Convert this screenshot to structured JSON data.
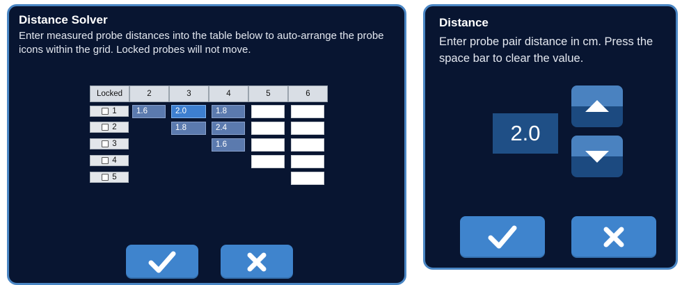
{
  "solver": {
    "title": "Distance Solver",
    "description": "Enter measured probe distances into the table below to auto-arrange the probe icons within the grid.  Locked probes will not move.",
    "headers": [
      "Locked",
      "2",
      "3",
      "4",
      "5",
      "6"
    ],
    "rows": [
      {
        "probe": "1",
        "cells": [
          "1.6",
          "2.0",
          "1.8",
          "",
          ""
        ]
      },
      {
        "probe": "2",
        "cells": [
          "1.8",
          "2.4",
          "",
          ""
        ]
      },
      {
        "probe": "3",
        "cells": [
          "1.6",
          "",
          ""
        ]
      },
      {
        "probe": "4",
        "cells": [
          "",
          ""
        ]
      },
      {
        "probe": "5",
        "cells": [
          ""
        ]
      }
    ],
    "selected_cell": "1-3"
  },
  "distance": {
    "title": "Distance",
    "description": "Enter probe pair distance in cm.  Press the space bar to clear the value.",
    "value": "2.0"
  },
  "icons": {
    "confirm": "check-icon",
    "cancel": "close-icon",
    "increment": "triangle-up-icon",
    "decrement": "triangle-down-icon"
  },
  "colors": {
    "panel_bg": "#081531",
    "panel_border": "#4a86c4",
    "button": "#3f84cd",
    "filled_cell": "#5b7aae",
    "selected_cell": "#3d7fd0"
  }
}
